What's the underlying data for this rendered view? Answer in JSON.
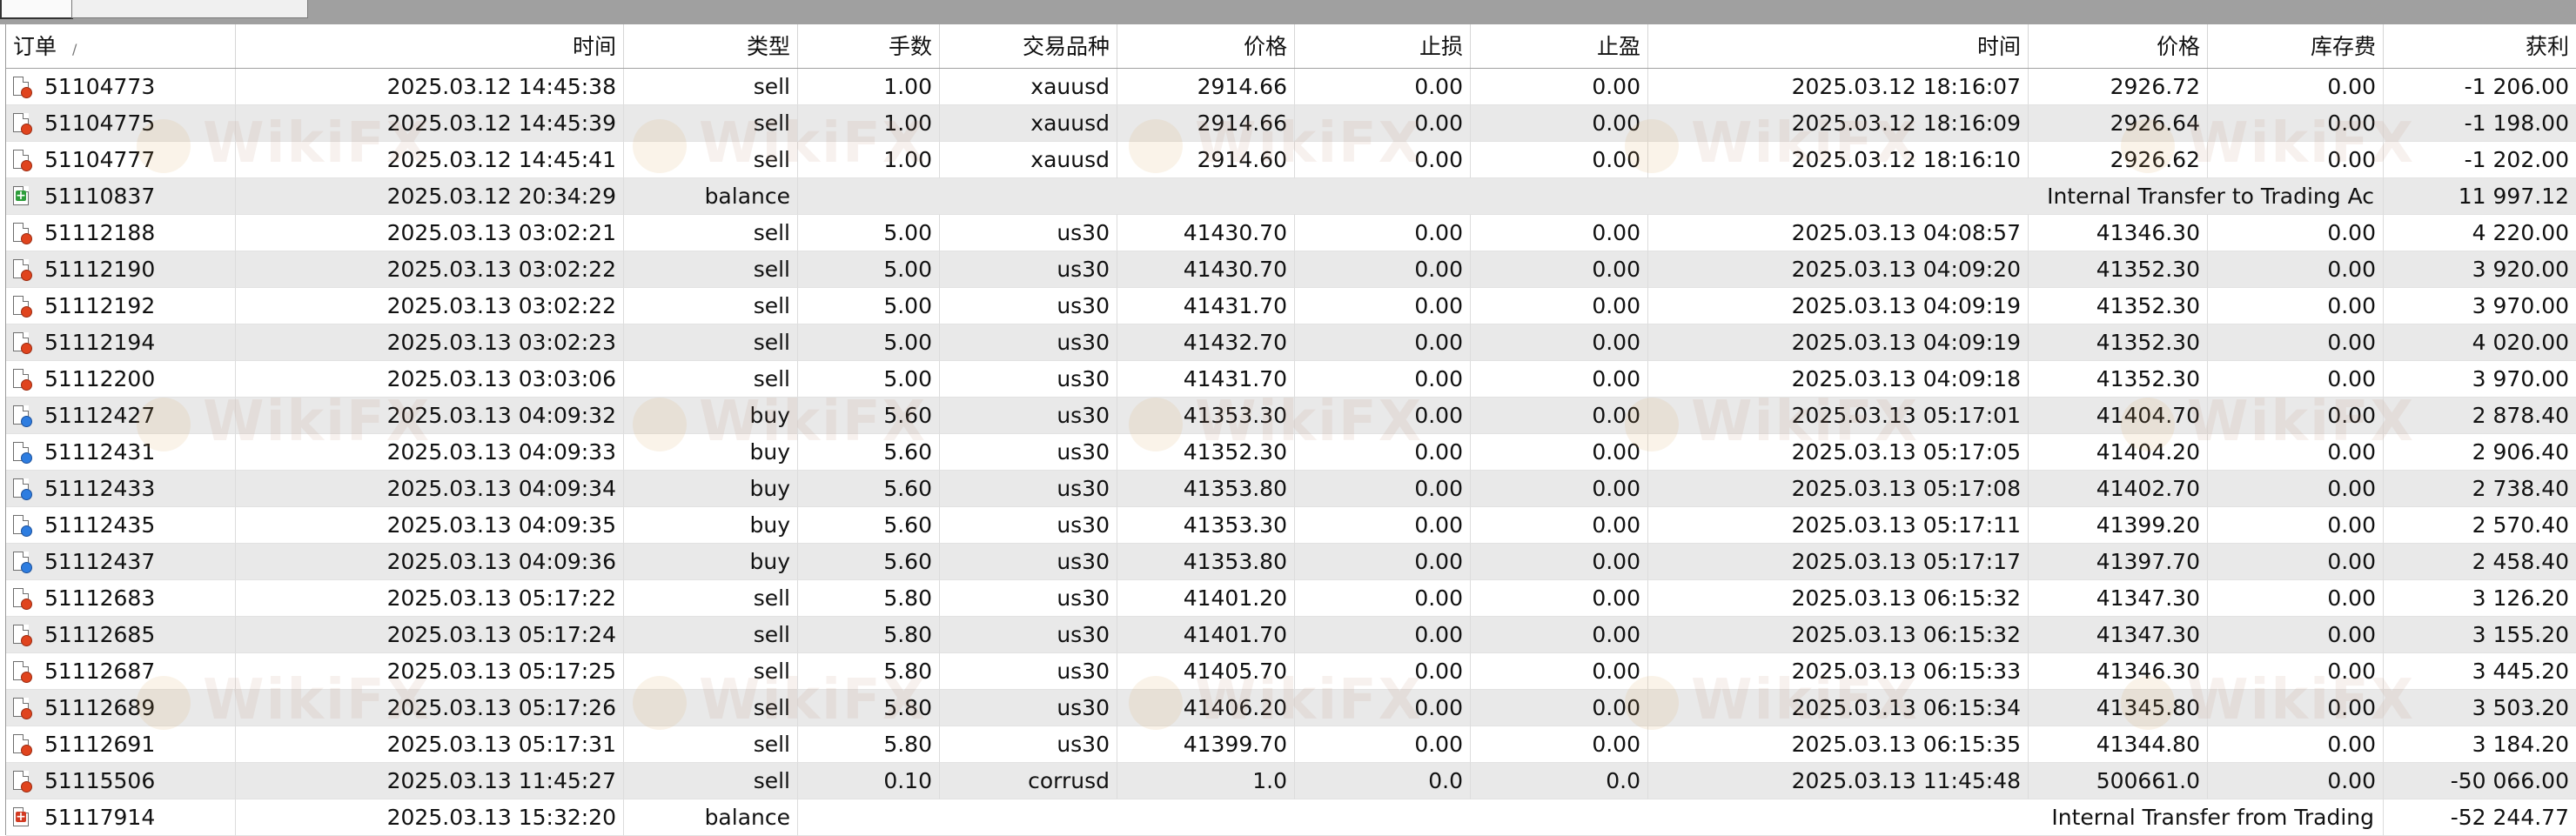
{
  "columns": {
    "order": "订单",
    "open_time": "时间",
    "type": "类型",
    "volume": "手数",
    "symbol": "交易品种",
    "open_price": "价格",
    "sl": "止损",
    "tp": "止盈",
    "close_time": "时间",
    "close_price": "价格",
    "swap": "库存费",
    "profit": "获利"
  },
  "sort_indicator": "/",
  "watermark_text": "WikiFX",
  "rows": [
    {
      "order": "51104773",
      "open_time": "2025.03.12 14:45:38",
      "type": "sell",
      "volume": "1.00",
      "symbol": "xauusd",
      "open_price": "2914.66",
      "sl": "0.00",
      "tp": "0.00",
      "close_time": "2025.03.12 18:16:07",
      "close_price": "2926.72",
      "swap": "0.00",
      "profit": "-1 206.00",
      "icon": "sell-order-icon"
    },
    {
      "order": "51104775",
      "open_time": "2025.03.12 14:45:39",
      "type": "sell",
      "volume": "1.00",
      "symbol": "xauusd",
      "open_price": "2914.66",
      "sl": "0.00",
      "tp": "0.00",
      "close_time": "2025.03.12 18:16:09",
      "close_price": "2926.64",
      "swap": "0.00",
      "profit": "-1 198.00",
      "icon": "sell-order-icon"
    },
    {
      "order": "51104777",
      "open_time": "2025.03.12 14:45:41",
      "type": "sell",
      "volume": "1.00",
      "symbol": "xauusd",
      "open_price": "2914.60",
      "sl": "0.00",
      "tp": "0.00",
      "close_time": "2025.03.12 18:16:10",
      "close_price": "2926.62",
      "swap": "0.00",
      "profit": "-1 202.00",
      "icon": "sell-order-icon"
    },
    {
      "order": "51110837",
      "open_time": "2025.03.12 20:34:29",
      "type": "balance",
      "comment": "Internal Transfer to Trading Ac",
      "profit": "11 997.12",
      "icon": "deposit-icon"
    },
    {
      "order": "51112188",
      "open_time": "2025.03.13 03:02:21",
      "type": "sell",
      "volume": "5.00",
      "symbol": "us30",
      "open_price": "41430.70",
      "sl": "0.00",
      "tp": "0.00",
      "close_time": "2025.03.13 04:08:57",
      "close_price": "41346.30",
      "swap": "0.00",
      "profit": "4 220.00",
      "icon": "sell-order-icon"
    },
    {
      "order": "51112190",
      "open_time": "2025.03.13 03:02:22",
      "type": "sell",
      "volume": "5.00",
      "symbol": "us30",
      "open_price": "41430.70",
      "sl": "0.00",
      "tp": "0.00",
      "close_time": "2025.03.13 04:09:20",
      "close_price": "41352.30",
      "swap": "0.00",
      "profit": "3 920.00",
      "icon": "sell-order-icon"
    },
    {
      "order": "51112192",
      "open_time": "2025.03.13 03:02:22",
      "type": "sell",
      "volume": "5.00",
      "symbol": "us30",
      "open_price": "41431.70",
      "sl": "0.00",
      "tp": "0.00",
      "close_time": "2025.03.13 04:09:19",
      "close_price": "41352.30",
      "swap": "0.00",
      "profit": "3 970.00",
      "icon": "sell-order-icon"
    },
    {
      "order": "51112194",
      "open_time": "2025.03.13 03:02:23",
      "type": "sell",
      "volume": "5.00",
      "symbol": "us30",
      "open_price": "41432.70",
      "sl": "0.00",
      "tp": "0.00",
      "close_time": "2025.03.13 04:09:19",
      "close_price": "41352.30",
      "swap": "0.00",
      "profit": "4 020.00",
      "icon": "sell-order-icon"
    },
    {
      "order": "51112200",
      "open_time": "2025.03.13 03:03:06",
      "type": "sell",
      "volume": "5.00",
      "symbol": "us30",
      "open_price": "41431.70",
      "sl": "0.00",
      "tp": "0.00",
      "close_time": "2025.03.13 04:09:18",
      "close_price": "41352.30",
      "swap": "0.00",
      "profit": "3 970.00",
      "icon": "sell-order-icon"
    },
    {
      "order": "51112427",
      "open_time": "2025.03.13 04:09:32",
      "type": "buy",
      "volume": "5.60",
      "symbol": "us30",
      "open_price": "41353.30",
      "sl": "0.00",
      "tp": "0.00",
      "close_time": "2025.03.13 05:17:01",
      "close_price": "41404.70",
      "swap": "0.00",
      "profit": "2 878.40",
      "icon": "buy-order-icon"
    },
    {
      "order": "51112431",
      "open_time": "2025.03.13 04:09:33",
      "type": "buy",
      "volume": "5.60",
      "symbol": "us30",
      "open_price": "41352.30",
      "sl": "0.00",
      "tp": "0.00",
      "close_time": "2025.03.13 05:17:05",
      "close_price": "41404.20",
      "swap": "0.00",
      "profit": "2 906.40",
      "icon": "buy-order-icon"
    },
    {
      "order": "51112433",
      "open_time": "2025.03.13 04:09:34",
      "type": "buy",
      "volume": "5.60",
      "symbol": "us30",
      "open_price": "41353.80",
      "sl": "0.00",
      "tp": "0.00",
      "close_time": "2025.03.13 05:17:08",
      "close_price": "41402.70",
      "swap": "0.00",
      "profit": "2 738.40",
      "icon": "buy-order-icon"
    },
    {
      "order": "51112435",
      "open_time": "2025.03.13 04:09:35",
      "type": "buy",
      "volume": "5.60",
      "symbol": "us30",
      "open_price": "41353.30",
      "sl": "0.00",
      "tp": "0.00",
      "close_time": "2025.03.13 05:17:11",
      "close_price": "41399.20",
      "swap": "0.00",
      "profit": "2 570.40",
      "icon": "buy-order-icon"
    },
    {
      "order": "51112437",
      "open_time": "2025.03.13 04:09:36",
      "type": "buy",
      "volume": "5.60",
      "symbol": "us30",
      "open_price": "41353.80",
      "sl": "0.00",
      "tp": "0.00",
      "close_time": "2025.03.13 05:17:17",
      "close_price": "41397.70",
      "swap": "0.00",
      "profit": "2 458.40",
      "icon": "buy-order-icon"
    },
    {
      "order": "51112683",
      "open_time": "2025.03.13 05:17:22",
      "type": "sell",
      "volume": "5.80",
      "symbol": "us30",
      "open_price": "41401.20",
      "sl": "0.00",
      "tp": "0.00",
      "close_time": "2025.03.13 06:15:32",
      "close_price": "41347.30",
      "swap": "0.00",
      "profit": "3 126.20",
      "icon": "sell-order-icon"
    },
    {
      "order": "51112685",
      "open_time": "2025.03.13 05:17:24",
      "type": "sell",
      "volume": "5.80",
      "symbol": "us30",
      "open_price": "41401.70",
      "sl": "0.00",
      "tp": "0.00",
      "close_time": "2025.03.13 06:15:32",
      "close_price": "41347.30",
      "swap": "0.00",
      "profit": "3 155.20",
      "icon": "sell-order-icon"
    },
    {
      "order": "51112687",
      "open_time": "2025.03.13 05:17:25",
      "type": "sell",
      "volume": "5.80",
      "symbol": "us30",
      "open_price": "41405.70",
      "sl": "0.00",
      "tp": "0.00",
      "close_time": "2025.03.13 06:15:33",
      "close_price": "41346.30",
      "swap": "0.00",
      "profit": "3 445.20",
      "icon": "sell-order-icon"
    },
    {
      "order": "51112689",
      "open_time": "2025.03.13 05:17:26",
      "type": "sell",
      "volume": "5.80",
      "symbol": "us30",
      "open_price": "41406.20",
      "sl": "0.00",
      "tp": "0.00",
      "close_time": "2025.03.13 06:15:34",
      "close_price": "41345.80",
      "swap": "0.00",
      "profit": "3 503.20",
      "icon": "sell-order-icon"
    },
    {
      "order": "51112691",
      "open_time": "2025.03.13 05:17:31",
      "type": "sell",
      "volume": "5.80",
      "symbol": "us30",
      "open_price": "41399.70",
      "sl": "0.00",
      "tp": "0.00",
      "close_time": "2025.03.13 06:15:35",
      "close_price": "41344.80",
      "swap": "0.00",
      "profit": "3 184.20",
      "icon": "sell-order-icon"
    },
    {
      "order": "51115506",
      "open_time": "2025.03.13 11:45:27",
      "type": "sell",
      "volume": "0.10",
      "symbol": "corrusd",
      "open_price": "1.0",
      "sl": "0.0",
      "tp": "0.0",
      "close_time": "2025.03.13 11:45:48",
      "close_price": "500661.0",
      "swap": "0.00",
      "profit": "-50 066.00",
      "icon": "sell-order-icon"
    },
    {
      "order": "51117914",
      "open_time": "2025.03.13 15:32:20",
      "type": "balance",
      "comment": "Internal Transfer from Trading",
      "profit": "-52 244.77",
      "icon": "withdrawal-icon"
    }
  ]
}
